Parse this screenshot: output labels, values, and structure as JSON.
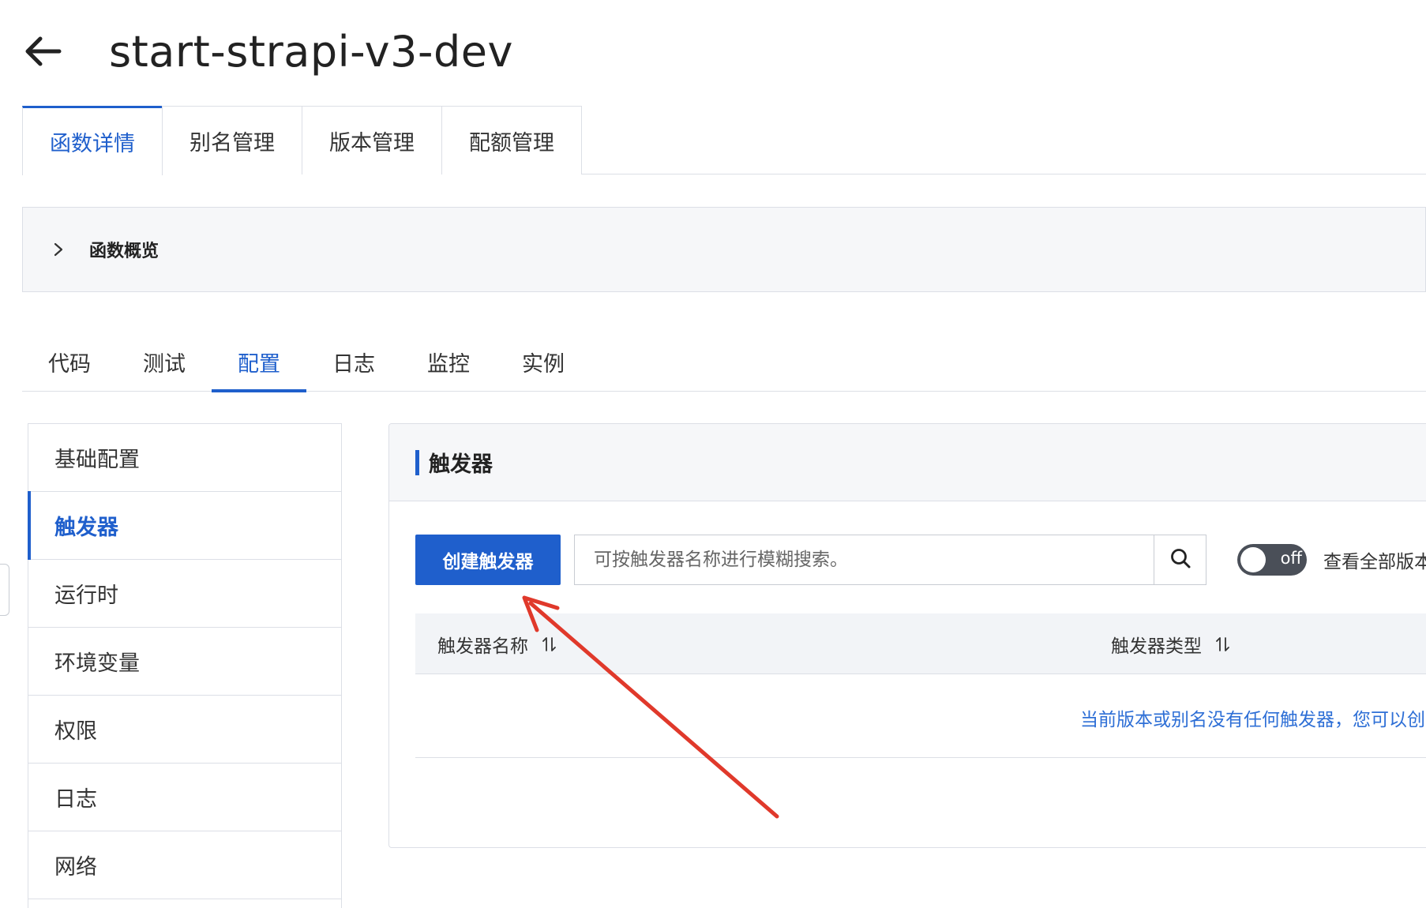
{
  "header": {
    "title": "start-strapi-v3-dev",
    "back_icon": "arrow-left-icon"
  },
  "top_tabs": [
    {
      "label": "函数详情",
      "active": true
    },
    {
      "label": "别名管理",
      "active": false
    },
    {
      "label": "版本管理",
      "active": false
    },
    {
      "label": "配额管理",
      "active": false
    }
  ],
  "overview": {
    "label": "函数概览",
    "icon": "chevron-right-icon"
  },
  "sub_tabs": [
    {
      "label": "代码",
      "active": false
    },
    {
      "label": "测试",
      "active": false
    },
    {
      "label": "配置",
      "active": true
    },
    {
      "label": "日志",
      "active": false
    },
    {
      "label": "监控",
      "active": false
    },
    {
      "label": "实例",
      "active": false
    }
  ],
  "config_nav": [
    {
      "label": "基础配置",
      "active": false
    },
    {
      "label": "触发器",
      "active": true
    },
    {
      "label": "运行时",
      "active": false
    },
    {
      "label": "环境变量",
      "active": false
    },
    {
      "label": "权限",
      "active": false
    },
    {
      "label": "日志",
      "active": false
    },
    {
      "label": "网络",
      "active": false
    }
  ],
  "trigger_card": {
    "title": "触发器",
    "create_label": "创建触发器",
    "search_placeholder": "可按触发器名称进行模糊搜索。",
    "search_icon": "search-icon",
    "toggle_state": "off",
    "toggle_label": "查看全部版本",
    "columns": [
      {
        "label": "触发器名称",
        "icon": "sort-icon"
      },
      {
        "label": "触发器类型",
        "icon": "sort-icon"
      }
    ],
    "empty_text": "当前版本或别名没有任何触发器，您可以创"
  },
  "colors": {
    "primary": "#1f5fcc",
    "link": "#2e6fd6",
    "annotation_arrow": "#e0392b",
    "toggle_off": "#4a4f58"
  }
}
